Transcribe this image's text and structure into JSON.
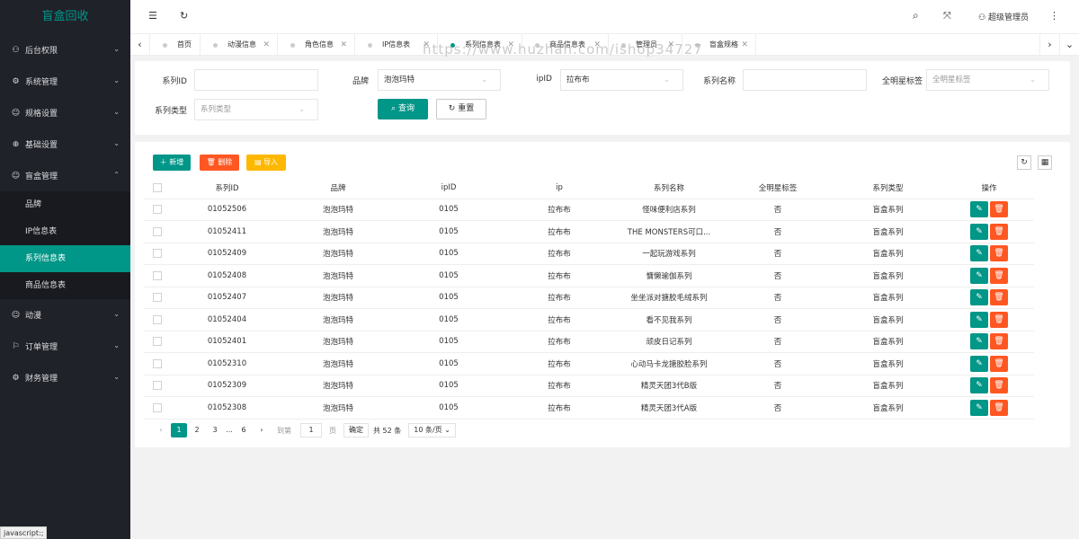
{
  "sidebar": {
    "logo": "盲盒回收",
    "items": [
      {
        "label": "后台权限",
        "icon": "user-icon",
        "glyph": "⚇",
        "chev": "⌄"
      },
      {
        "label": "系统管理",
        "icon": "gear-icon",
        "glyph": "⚙",
        "chev": "⌄"
      },
      {
        "label": "规格设置",
        "icon": "smile-icon",
        "glyph": "☺",
        "chev": "⌄"
      },
      {
        "label": "基础设置",
        "icon": "globe-icon",
        "glyph": "⊕",
        "chev": "⌄"
      },
      {
        "label": "盲盒管理",
        "icon": "smile-icon",
        "glyph": "☺",
        "chev": "⌃"
      },
      {
        "label": "动漫",
        "icon": "smile-icon",
        "glyph": "☺",
        "chev": "⌄"
      },
      {
        "label": "订单管理",
        "icon": "flag-icon",
        "glyph": "⚐",
        "chev": "⌄"
      },
      {
        "label": "财务管理",
        "icon": "settings-icon",
        "glyph": "⚙",
        "chev": "⌄"
      }
    ],
    "subitems": [
      "品牌",
      "IP信息表",
      "系列信息表",
      "商品信息表"
    ],
    "active_sub": 2,
    "status_text": "javascript:;"
  },
  "header": {
    "menu_glyph": "☰",
    "refresh_glyph": "↻",
    "search_glyph": "⌕",
    "fullscreen_glyph": "⤧",
    "admin_label": "⚇ 超级管理员",
    "more_glyph": "⋮"
  },
  "tabs": {
    "prev": "‹",
    "next": "›",
    "menu": "⌄",
    "close": "✕",
    "items": [
      "首页",
      "动漫信息",
      "角色信息",
      "IP信息表",
      "系列信息表",
      "商品信息表",
      "管理员",
      "盲盒规格"
    ]
  },
  "watermark": "https://www.huzhan.com/ishop34727",
  "filters": {
    "series_id_label": "系列ID",
    "series_id_value": "",
    "brand_label": "品牌",
    "brand_value": "泡泡玛特",
    "ipid_label": "ipID",
    "ipid_value": "拉布布",
    "series_name_label": "系列名称",
    "series_name_value": "",
    "star_label": "全明星标签",
    "star_placeholder": "全明星标签",
    "type_label": "系列类型",
    "type_placeholder": "系列类型",
    "caret": "⌄",
    "query_label": "⌕ 查询",
    "reset_label": "↻ 重置"
  },
  "toolbar": {
    "add_label": "＋ 新增",
    "delete_label": "🗑 删除",
    "import_label": "▤ 导入",
    "refresh_glyph": "↻",
    "columns_glyph": "▦"
  },
  "table": {
    "headers": [
      "系列ID",
      "品牌",
      "ipID",
      "ip",
      "系列名称",
      "全明星标签",
      "系列类型",
      "操作"
    ],
    "rows": [
      [
        "01052506",
        "泡泡玛特",
        "0105",
        "拉布布",
        "怪味便利店系列",
        "否",
        "盲盒系列"
      ],
      [
        "01052411",
        "泡泡玛特",
        "0105",
        "拉布布",
        "THE MONSTERS可口...",
        "否",
        "盲盒系列"
      ],
      [
        "01052409",
        "泡泡玛特",
        "0105",
        "拉布布",
        "一起玩游戏系列",
        "否",
        "盲盒系列"
      ],
      [
        "01052408",
        "泡泡玛特",
        "0105",
        "拉布布",
        "慵懒瑜伽系列",
        "否",
        "盲盒系列"
      ],
      [
        "01052407",
        "泡泡玛特",
        "0105",
        "拉布布",
        "坐坐派对搪胶毛绒系列",
        "否",
        "盲盒系列"
      ],
      [
        "01052404",
        "泡泡玛特",
        "0105",
        "拉布布",
        "看不见我系列",
        "否",
        "盲盒系列"
      ],
      [
        "01052401",
        "泡泡玛特",
        "0105",
        "拉布布",
        "顽皮日记系列",
        "否",
        "盲盒系列"
      ],
      [
        "01052310",
        "泡泡玛特",
        "0105",
        "拉布布",
        "心动马卡龙搪胶脸系列",
        "否",
        "盲盒系列"
      ],
      [
        "01052309",
        "泡泡玛特",
        "0105",
        "拉布布",
        "精灵天团3代B版",
        "否",
        "盲盒系列"
      ],
      [
        "01052308",
        "泡泡玛特",
        "0105",
        "拉布布",
        "精灵天团3代A版",
        "否",
        "盲盒系列"
      ]
    ],
    "edit_glyph": "✎",
    "delete_glyph": "🗑"
  },
  "pagination": {
    "prev": "‹",
    "next": "›",
    "pages": [
      "1",
      "2",
      "3",
      "...",
      "6"
    ],
    "goto_label": "到第",
    "goto_value": "1",
    "page_unit": "页",
    "confirm_label": "确定",
    "total_label": "共 52 条",
    "page_size": "10 条/页 ⌄"
  },
  "colors": {
    "accent": "#009688",
    "danger": "#ff5722",
    "warning": "#ffb800",
    "sidebar_bg": "#20222a"
  }
}
